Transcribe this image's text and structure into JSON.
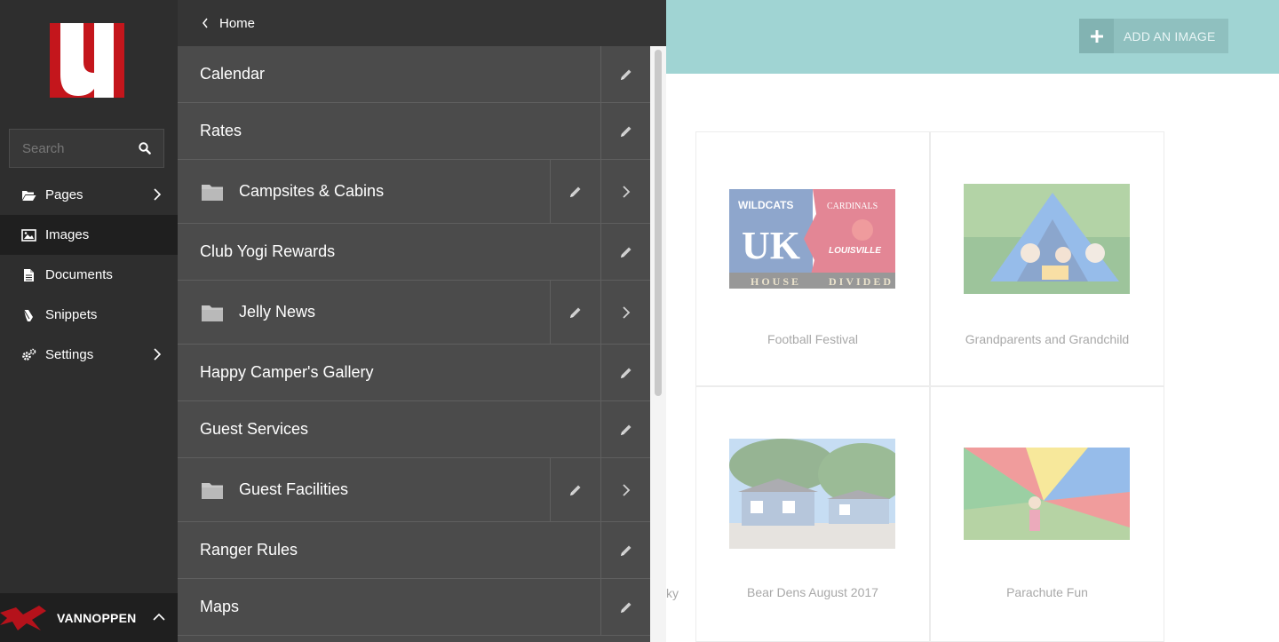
{
  "sidebar": {
    "logo": "u",
    "search": {
      "placeholder": "Search",
      "icon": "search-icon"
    },
    "nav": [
      {
        "label": "Pages",
        "icon": "folder-open-icon",
        "has_submenu": true
      },
      {
        "label": "Images",
        "icon": "image-icon",
        "active": true
      },
      {
        "label": "Documents",
        "icon": "document-icon"
      },
      {
        "label": "Snippets",
        "icon": "snippet-icon"
      },
      {
        "label": "Settings",
        "icon": "gears-icon",
        "has_submenu": true
      }
    ],
    "user": {
      "name": "VANNOPPEN",
      "icon": "chevron-up-icon"
    }
  },
  "panel": {
    "back_label": "Home",
    "rows": [
      {
        "label": "Calendar",
        "folder": false
      },
      {
        "label": "Rates",
        "folder": false
      },
      {
        "label": "Campsites & Cabins",
        "folder": true
      },
      {
        "label": "Club Yogi Rewards",
        "folder": false
      },
      {
        "label": "Jelly News",
        "folder": true
      },
      {
        "label": "Happy Camper's Gallery",
        "folder": false
      },
      {
        "label": "Guest Services",
        "folder": false
      },
      {
        "label": "Guest Facilities",
        "folder": true
      },
      {
        "label": "Ranger Rules",
        "folder": false
      },
      {
        "label": "Maps",
        "folder": false
      }
    ]
  },
  "main": {
    "add_button_label": "ADD AN IMAGE",
    "images": [
      {
        "caption": "Football Festival",
        "thumb_text": {
          "left_top": "WILDCATS",
          "left_logo": "UK",
          "left_bottom": "HOUSE",
          "right_top": "CARDINALS",
          "right_logo": "LOUISVILLE",
          "right_bottom": "DIVIDED"
        }
      },
      {
        "caption": "Grandparents and Grandchild"
      },
      {
        "caption": "Bear Dens August 2017"
      },
      {
        "caption": "Parachute Fun"
      }
    ],
    "partial_caption": "ky"
  },
  "colors": {
    "sidebar": "#2e2e2e",
    "panel": "#4b4b4b",
    "teal": "#a0d4d3",
    "brand_red": "#c4161c"
  }
}
